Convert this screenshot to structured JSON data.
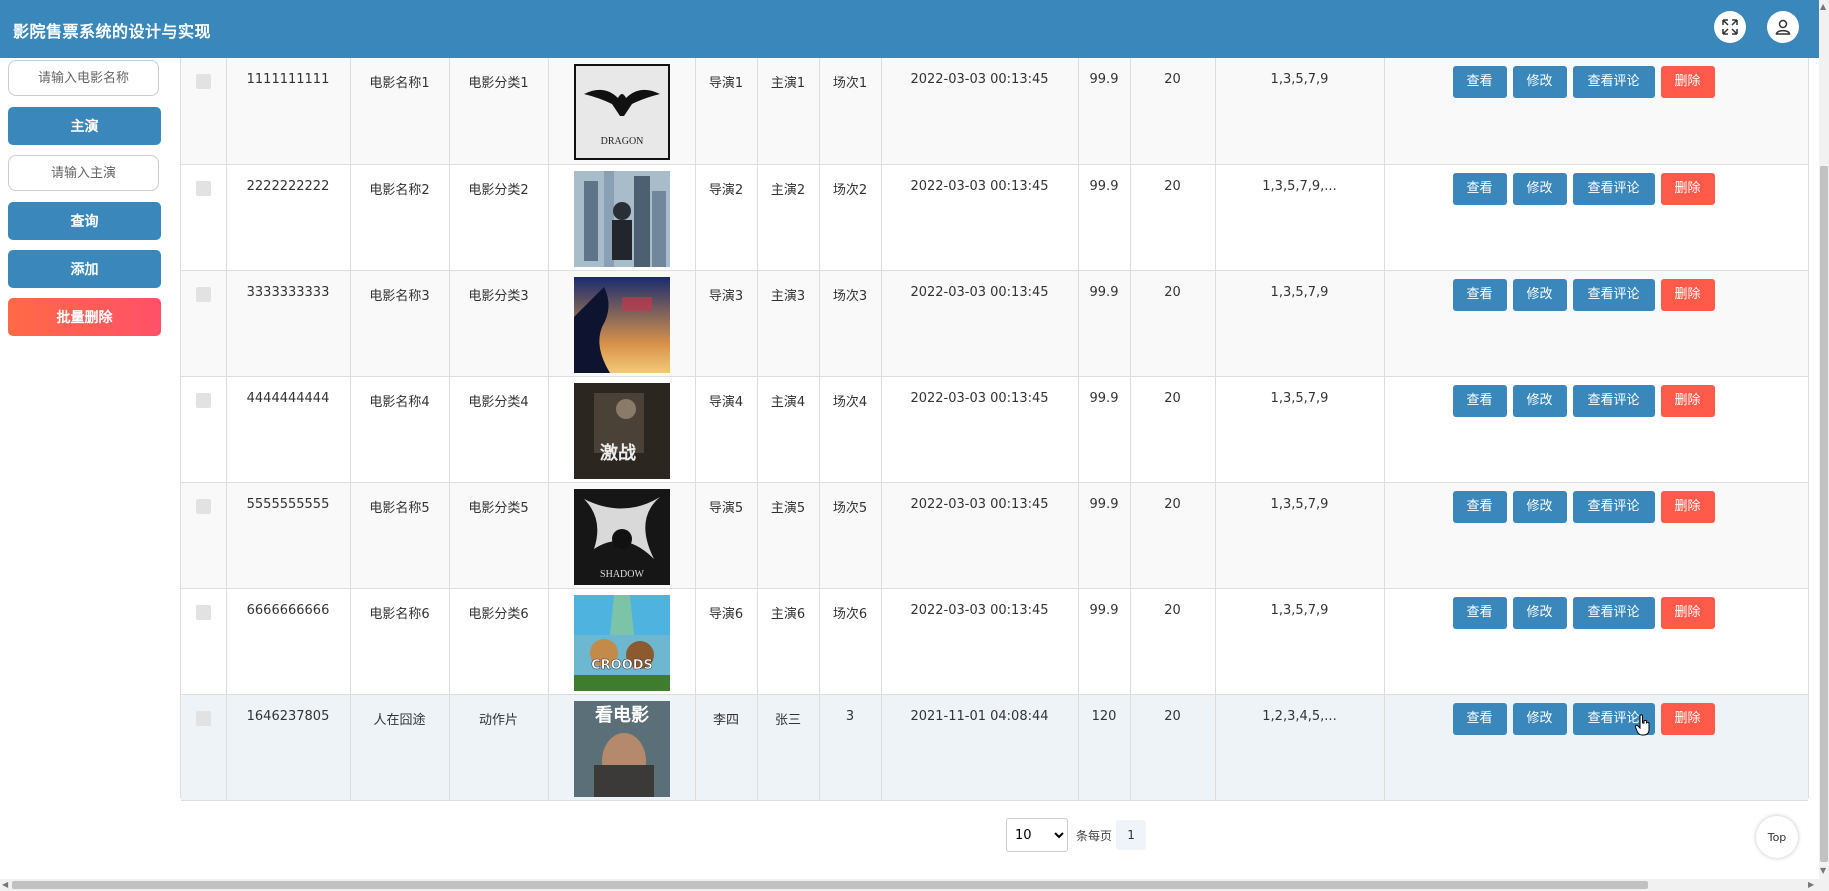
{
  "header": {
    "title": "影院售票系统的设计与实现",
    "fullscreen_icon": "fullscreen-icon",
    "user_icon": "user-icon"
  },
  "sidebar": {
    "movie_name_placeholder": "请输入电影名称",
    "actor_label": "主演",
    "actor_placeholder": "请输入主演",
    "query_label": "查询",
    "add_label": "添加",
    "batch_delete_label": "批量删除"
  },
  "actions": {
    "view": "查看",
    "edit": "修改",
    "comments": "查看评论",
    "delete": "删除"
  },
  "rows": [
    {
      "id": "1111111111",
      "name": "电影名称1",
      "category": "电影分类1",
      "director": "导演1",
      "actor": "主演1",
      "session": "场次1",
      "time": "2022-03-03 00:13:45",
      "price": "99.9",
      "seats": "20",
      "days": "1,3,5,7,9",
      "poster": "poster-dragon"
    },
    {
      "id": "2222222222",
      "name": "电影名称2",
      "category": "电影分类2",
      "director": "导演2",
      "actor": "主演2",
      "session": "场次2",
      "time": "2022-03-03 00:13:45",
      "price": "99.9",
      "seats": "20",
      "days": "1,3,5,7,9,...",
      "poster": "poster-city"
    },
    {
      "id": "3333333333",
      "name": "电影名称3",
      "category": "电影分类3",
      "director": "导演3",
      "actor": "主演3",
      "session": "场次3",
      "time": "2022-03-03 00:13:45",
      "price": "99.9",
      "seats": "20",
      "days": "1,3,5,7,9",
      "poster": "poster-sunset"
    },
    {
      "id": "4444444444",
      "name": "电影名称4",
      "category": "电影分类4",
      "director": "导演4",
      "actor": "主演4",
      "session": "场次4",
      "time": "2022-03-03 00:13:45",
      "price": "99.9",
      "seats": "20",
      "days": "1,3,5,7,9",
      "poster": "poster-battle"
    },
    {
      "id": "5555555555",
      "name": "电影名称5",
      "category": "电影分类5",
      "director": "导演5",
      "actor": "主演5",
      "session": "场次5",
      "time": "2022-03-03 00:13:45",
      "price": "99.9",
      "seats": "20",
      "days": "1,3,5,7,9",
      "poster": "poster-shadow"
    },
    {
      "id": "6666666666",
      "name": "电影名称6",
      "category": "电影分类6",
      "director": "导演6",
      "actor": "主演6",
      "session": "场次6",
      "time": "2022-03-03 00:13:45",
      "price": "99.9",
      "seats": "20",
      "days": "1,3,5,7,9",
      "poster": "poster-croods"
    },
    {
      "id": "1646237805",
      "name": "人在囧途",
      "category": "动作片",
      "director": "李四",
      "actor": "张三",
      "session": "3",
      "time": "2021-11-01 04:08:44",
      "price": "120",
      "seats": "20",
      "days": "1,2,3,4,5,...",
      "poster": "poster-magazine"
    }
  ],
  "posters": {
    "dragon_text": "DRAGON",
    "shadow_text": "SHADOW",
    "croods_text": "CROODS",
    "battle_text": "激战",
    "magazine_text": "看电影"
  },
  "pager": {
    "page_size": "10",
    "page_size_options": [
      "10"
    ],
    "per_page_label": "条每页",
    "current_page": "1"
  },
  "top_button": "Top",
  "colors": {
    "primary": "#3a88bb",
    "danger": "#ff5a4a"
  }
}
